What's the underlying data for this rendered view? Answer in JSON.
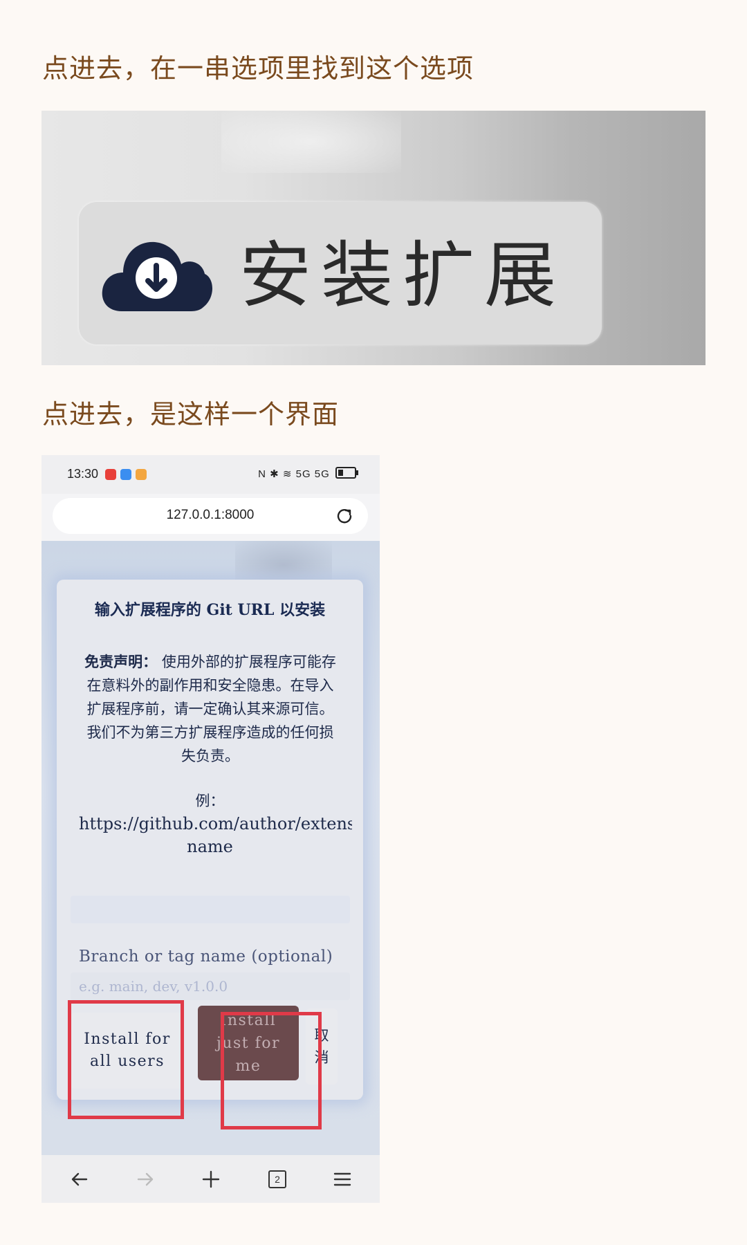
{
  "article": {
    "caption_1": "点进去，在一串选项里找到这个选项",
    "caption_2": "点进去，是这样一个界面"
  },
  "install_button": {
    "label": "安装扩展",
    "icon": "cloud-download-icon",
    "icon_color": "#1a2440"
  },
  "phone": {
    "status_bar": {
      "time": "13:30",
      "right_text": "N ✱ ≋ 5G 5G",
      "app_icon_colors": [
        "#e8403a",
        "#3b8ef0",
        "#f3a640"
      ]
    },
    "url_bar": {
      "url": "127.0.0.1:8000",
      "reload_icon": "reload-icon"
    },
    "dialog": {
      "title": "输入扩展程序的 Git URL 以安装",
      "disclaimer_label": "免责声明：",
      "disclaimer_text": "使用外部的扩展程序可能存在意料外的副作用和安全隐患。在导入扩展程序前，请一定确认其来源可信。我们不为第三方扩展程序造成的任何损失负责。",
      "example_label": "例：",
      "example_url": "https://github.com/author/extension-",
      "example_name": "name",
      "branch_label": "Branch or tag name (optional)",
      "branch_placeholder": "e.g. main, dev, v1.0.0",
      "btn_all_users": "Install for all users",
      "btn_just_me": "Install just for me",
      "btn_cancel": "取消"
    },
    "bottom_nav": {
      "tab_count": "2",
      "icons": [
        "back-arrow-icon",
        "forward-arrow-icon",
        "plus-icon",
        "tabs-icon",
        "menu-icon"
      ]
    },
    "highlight_color": "#e03a48"
  }
}
